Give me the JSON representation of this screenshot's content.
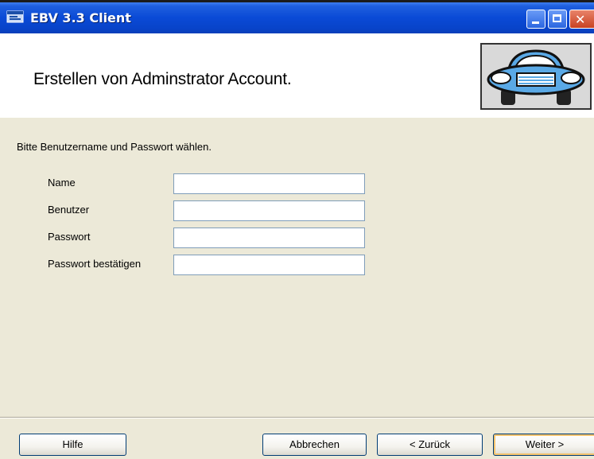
{
  "window": {
    "title": "EBV 3.3 Client",
    "close_glyph": "✕"
  },
  "header": {
    "title": "Erstellen von Adminstrator Account."
  },
  "form": {
    "instruction": "Bitte Benutzername und Passwort wählen.",
    "fields": [
      {
        "label": "Name",
        "value": ""
      },
      {
        "label": "Benutzer",
        "value": ""
      },
      {
        "label": "Passwort",
        "value": ""
      },
      {
        "label": "Passwort bestätigen",
        "value": ""
      }
    ]
  },
  "footer": {
    "help_label": "Hilfe",
    "cancel_label": "Abbrechen",
    "back_label": "< Zurück",
    "next_label": "Weiter >"
  },
  "colors": {
    "titlebar": "#0a4ad6",
    "dialog_bg": "#ece9d8",
    "header_bg": "#ffffff",
    "car_body": "#5aa9e6",
    "input_border": "#7f9db9"
  },
  "icons": {
    "app": "app-window-icon",
    "logo": "car-icon"
  }
}
